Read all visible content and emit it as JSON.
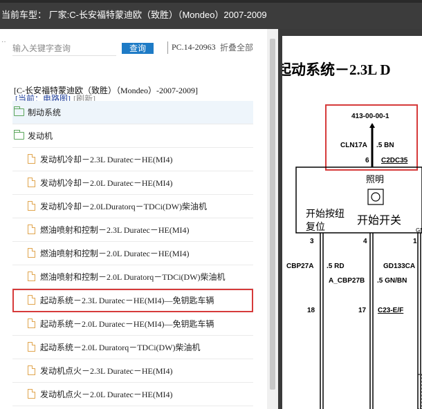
{
  "header": {
    "vehicle_line": "当前车型： 厂家:C-长安福特蒙迪欧（致胜）（Mondeo）2007-2009"
  },
  "search": {
    "placeholder": "输入关键字查询",
    "button_label": "查询",
    "part_number": "PC.14-20963",
    "collapse_all": "折叠全部"
  },
  "breadcrumb": {
    "vehicle": "[C-长安福特蒙迪欧（致胜）（Mondeo）-2007-2009]",
    "current": "[当前：电路图]",
    "refresh": "[刷新]"
  },
  "tree": {
    "folders": [
      {
        "label": "制动系统"
      },
      {
        "label": "发动机"
      }
    ],
    "files": [
      {
        "label": "发动机冷却－2.3L Duratec－HE(MI4)"
      },
      {
        "label": "发动机冷却－2.0L Duratec－HE(MI4)"
      },
      {
        "label": "发动机冷却－2.0LDuratorq－TDCi(DW)柴油机"
      },
      {
        "label": "燃油喷射和控制－2.3L Duratec－HE(MI4)"
      },
      {
        "label": "燃油喷射和控制－2.0L Duratec－HE(MI4)"
      },
      {
        "label": "燃油喷射和控制－2.0L Duratorq－TDCi(DW)柴油机"
      },
      {
        "label": "起动系统－2.3L Duratec－HE(MI4)—免钥匙车辆"
      },
      {
        "label": "起动系统－2.0L Duratec－HE(MI4)—免钥匙车辆"
      },
      {
        "label": "起动系统－2.0L Duratorq－TDCi(DW)柴油机"
      },
      {
        "label": "发动机点火－2.3L Duratec－HE(MI4)"
      },
      {
        "label": "发动机点火－2.0L Duratec－HE(MI4)"
      }
    ]
  },
  "diagram": {
    "title": "起动系统－2.3L D",
    "ref": "413-00-00-1",
    "cln": "CLN17A",
    "wire_top": ".5 BN",
    "pin_top": "6",
    "conn_top": "C2DC35",
    "label_illum": "照明",
    "label_start_btn": "开始按纽",
    "label_reset": "复位",
    "label_start_switch": "开始开关",
    "label_gn": "GN",
    "pin3": "3",
    "pin4": "4",
    "pin1": "1",
    "wire_cbp27a": "CBP27A",
    "wire_5rd": ".5 RD",
    "wire_gd133ca": "GD133CA",
    "wire_cbp27b": "A_CBP27B",
    "wire_5gnbn": ".5 GN/BN",
    "pin18": "18",
    "pin17": "17",
    "conn_bottom": "C23-E/F",
    "colors": {
      "highlight_box": "#d63a3a"
    }
  }
}
